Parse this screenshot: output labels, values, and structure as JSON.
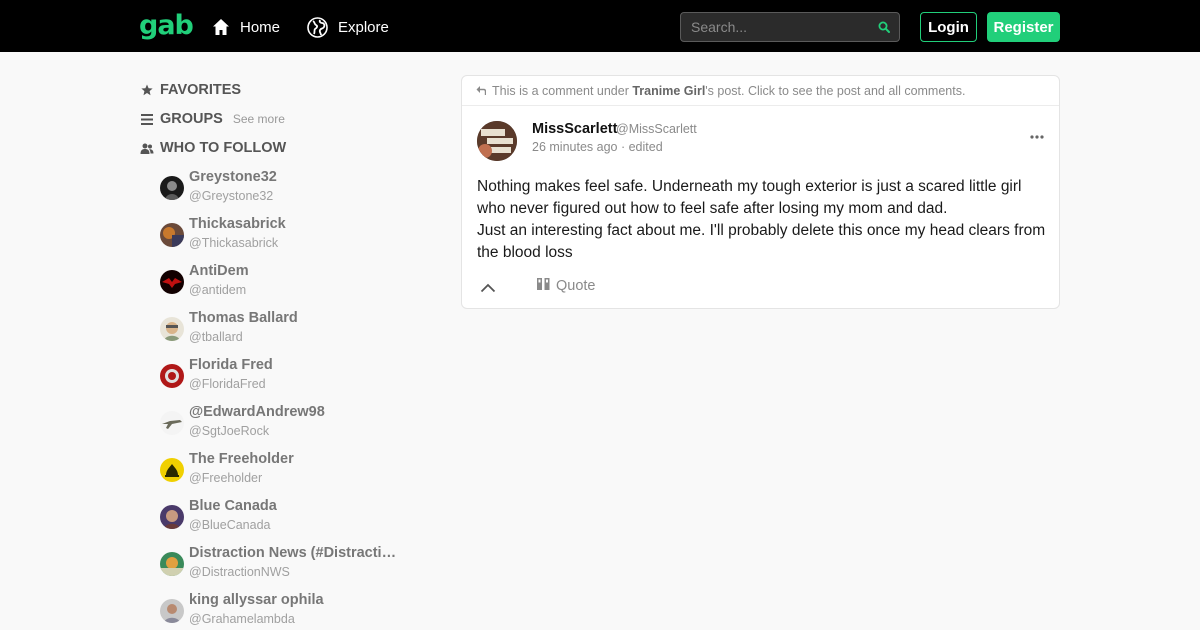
{
  "header": {
    "logo": "gab",
    "nav": [
      {
        "label": "Home",
        "icon": "home-icon"
      },
      {
        "label": "Explore",
        "icon": "globe-icon"
      }
    ],
    "search_placeholder": "Search...",
    "login_label": "Login",
    "register_label": "Register"
  },
  "sidebar": {
    "favorites_label": "FAVORITES",
    "groups_label": "GROUPS",
    "groups_see_more": "See more",
    "who_to_follow_label": "WHO TO FOLLOW",
    "follow": [
      {
        "name": "Greystone32",
        "handle": "@Greystone32"
      },
      {
        "name": "Thickasabrick",
        "handle": "@Thickasabrick"
      },
      {
        "name": "AntiDem",
        "handle": "@antidem"
      },
      {
        "name": "Thomas Ballard",
        "handle": "@tballard"
      },
      {
        "name": "Florida Fred",
        "handle": "@FloridaFred"
      },
      {
        "name": "@EdwardAndrew98",
        "handle": "@SgtJoeRock"
      },
      {
        "name": "The Freeholder",
        "handle": "@Freeholder"
      },
      {
        "name": "Blue Canada",
        "handle": "@BlueCanada"
      },
      {
        "name": "Distraction News (#DistractionNWS)",
        "handle": "@DistractionNWS"
      },
      {
        "name": "king allyssar ophila",
        "handle": "@Grahamelambda"
      }
    ]
  },
  "post": {
    "comment_note_prefix": "This is a comment under",
    "comment_note_author": "Tranime Girl",
    "comment_note_suffix": "'s post. Click to see the post and all comments.",
    "author_name": "MissScarlett",
    "author_handle": "@MissScarlett",
    "meta": "26 minutes ago · edited",
    "body_lines": [
      "Nothing makes feel safe. Underneath my tough exterior is just a scared little girl who never figured out how to feel safe after losing my mom and dad.",
      "Just an interesting fact about me. I'll probably delete this once my head clears from the blood loss"
    ],
    "quote_label": "Quote"
  },
  "colors": {
    "brand": "#21cf7a",
    "topbar": "#000000",
    "background": "#f9f9f9"
  }
}
